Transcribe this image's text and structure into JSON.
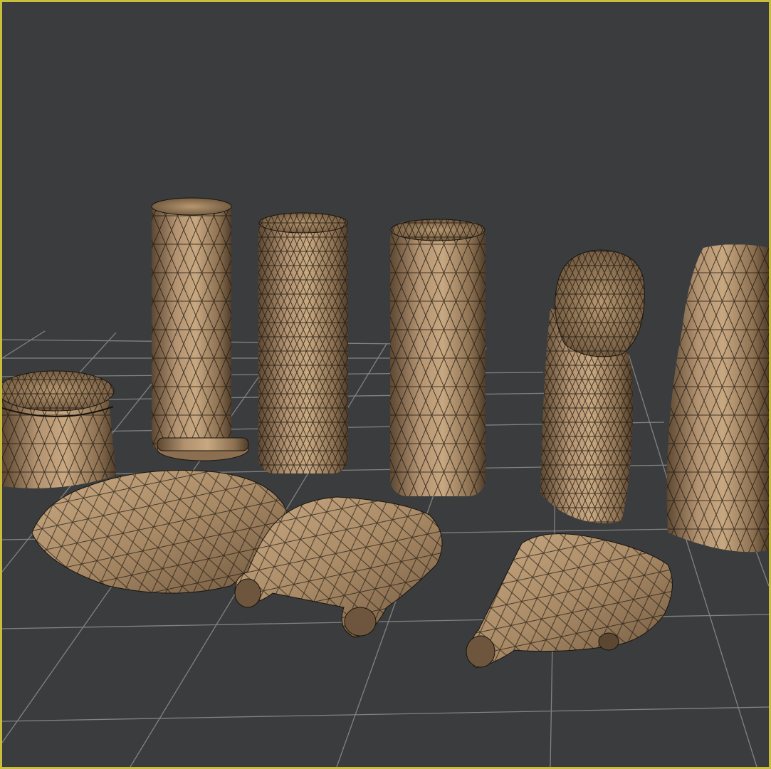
{
  "viewport": {
    "label": "",
    "active_border_color": "#c9bd3c",
    "background_color": "#3b3c3e",
    "grid_color": "#9a9a9a",
    "wire_color": "#1a140c",
    "material_colors": [
      "#c5a47e",
      "#a98a66",
      "#8b6f50",
      "#5c4732"
    ]
  },
  "scene": {
    "objects": [
      {
        "name": "short-round-box"
      },
      {
        "name": "tall-cylinder-1"
      },
      {
        "name": "tall-cylinder-2"
      },
      {
        "name": "tall-cylinder-3"
      },
      {
        "name": "bent-tube-bottle"
      },
      {
        "name": "square-bottle"
      },
      {
        "name": "flat-cushion"
      },
      {
        "name": "flat-bottle-1"
      },
      {
        "name": "flat-bottle-2"
      }
    ]
  }
}
